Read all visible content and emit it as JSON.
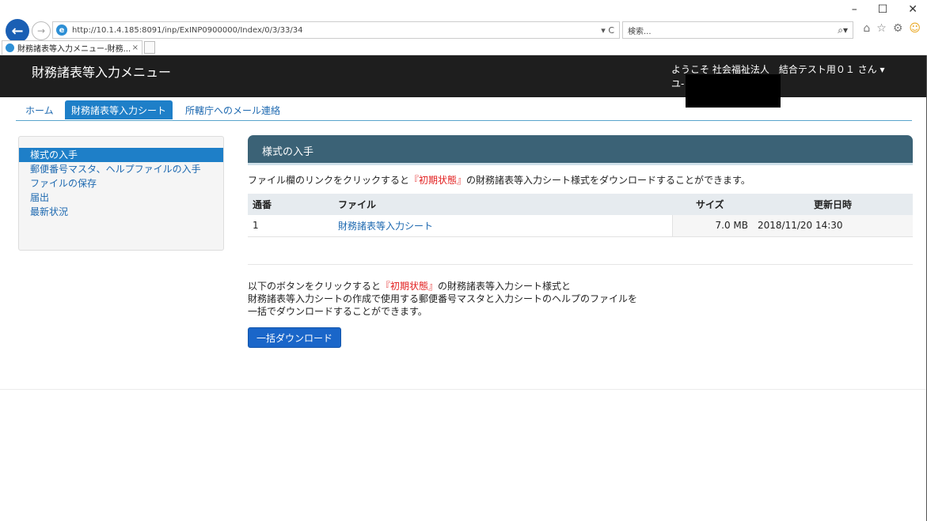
{
  "browser": {
    "url": "http://10.1.4.185:8091/inp/ExINP0900000/Index/0/3/33/34",
    "address_controls": "▾ C",
    "search_placeholder": "検索...",
    "search_icon": "search-icon",
    "tab_title": "財務諸表等入力メニュー-財務...",
    "tab_close": "×",
    "window_controls": {
      "minimize": "–",
      "maximize": "☐",
      "close": "✕"
    },
    "toolbar": {
      "home": "⌂",
      "favorites": "☆",
      "settings": "⚙",
      "feedback": "☺"
    }
  },
  "header": {
    "title": "財務諸表等入力メニュー",
    "welcome": "ようこそ 社会福祉法人　結合テスト用０１ さん ▾",
    "user_label": "ユ-"
  },
  "nav": {
    "tabs": [
      {
        "label": "ホーム"
      },
      {
        "label": "財務諸表等入力シート"
      },
      {
        "label": "所轄庁へのメール連絡"
      }
    ]
  },
  "sidebar": {
    "items": [
      {
        "label": "様式の入手"
      },
      {
        "label": "郵便番号マスタ、ヘルプファイルの入手"
      },
      {
        "label": "ファイルの保存"
      },
      {
        "label": "届出"
      },
      {
        "label": "最新状況"
      }
    ]
  },
  "panel": {
    "title": "様式の入手",
    "intro_pre": "ファイル欄のリンクをクリックすると",
    "intro_highlight": "『初期状態』",
    "intro_post": "の財務諸表等入力シート様式をダウンロードすることができます。",
    "table": {
      "headers": [
        "通番",
        "ファイル",
        "サイズ",
        "更新日時"
      ],
      "rows": [
        {
          "no": "1",
          "file": "財務諸表等入力シート",
          "size": "7.0 MB",
          "updated": "2018/11/20 14:30"
        }
      ]
    },
    "para_line1_pre": "以下のボタンをクリックすると",
    "para_line1_highlight": "『初期状態』",
    "para_line1_post": "の財務諸表等入力シート様式と",
    "para_line2": "財務諸表等入力シートの作成で使用する郵便番号マスタと入力シートのヘルプのファイルを",
    "para_line3": "一括でダウンロードすることができます。",
    "bulk_button": "一括ダウンロード"
  },
  "colors": {
    "header_bg": "#1e1e1e",
    "accent": "#1e7fc8",
    "panel_head": "#3b6276",
    "highlight_red": "#e21d1d"
  }
}
